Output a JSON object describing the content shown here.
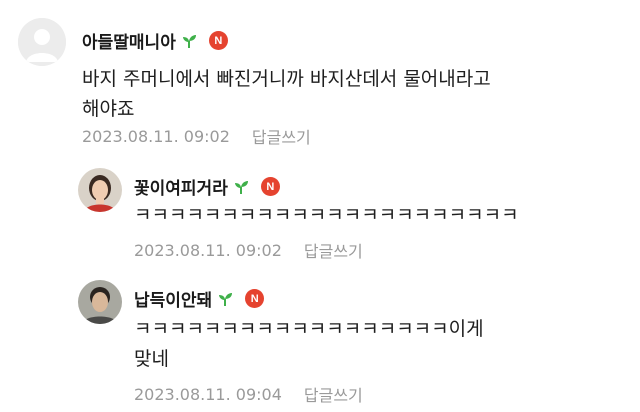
{
  "comments": [
    {
      "author": "아들딸매니아",
      "badge": "N",
      "text": "바지 주머니에서 빠진거니까 바지산데서 물어내라고\n해야죠",
      "timestamp": "2023.08.11. 09:02",
      "reply_label": "답글쓰기",
      "avatar": "default-avatar"
    },
    {
      "author": "꽃이여피거라",
      "badge": "N",
      "text": "ㅋㅋㅋㅋㅋㅋㅋㅋㅋㅋㅋㅋㅋㅋㅋㅋㅋㅋㅋㅋㅋㅋ",
      "timestamp": "2023.08.11. 09:02",
      "reply_label": "답글쓰기",
      "avatar": "profile-photo"
    },
    {
      "author": "납득이안돼",
      "badge": "N",
      "text": "ㅋㅋㅋㅋㅋㅋㅋㅋㅋㅋㅋㅋㅋㅋㅋㅋㅋㅋ이게\n맞네",
      "timestamp": "2023.08.11. 09:04",
      "reply_label": "답글쓰기",
      "avatar": "profile-photo"
    }
  ],
  "colors": {
    "badge": "#e5432f",
    "sprout": "#3fb04a",
    "meta": "#9a9a9a"
  }
}
